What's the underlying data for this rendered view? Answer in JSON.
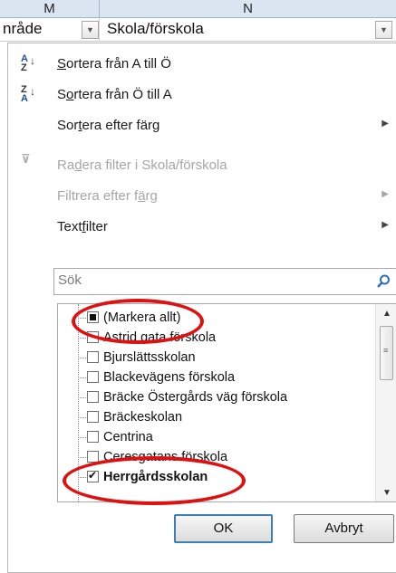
{
  "sheet": {
    "columns": [
      "M",
      "N"
    ],
    "header_cells": [
      "nråde",
      "Skola/förskola"
    ]
  },
  "menu": {
    "items": [
      {
        "label_pre": "",
        "label_u": "S",
        "label_post": "ortera från A till Ö",
        "disabled": false,
        "submenu": false,
        "icon": "sort-a-z-icon"
      },
      {
        "label_pre": "S",
        "label_u": "o",
        "label_post": "rtera från Ö till A",
        "disabled": false,
        "submenu": false,
        "icon": "sort-z-a-icon"
      },
      {
        "label_pre": "Sor",
        "label_u": "t",
        "label_post": "era efter färg",
        "disabled": false,
        "submenu": true,
        "icon": ""
      },
      {
        "label_pre": "Ra",
        "label_u": "d",
        "label_post": "era filter i Skola/förskola",
        "disabled": true,
        "submenu": false,
        "icon": "clear-filter-icon"
      },
      {
        "label_pre": "Filtrera efter f",
        "label_u": "ä",
        "label_post": "rg",
        "disabled": true,
        "submenu": true,
        "icon": ""
      },
      {
        "label_pre": "Text",
        "label_u": "f",
        "label_post": "ilter",
        "disabled": false,
        "submenu": true,
        "icon": ""
      }
    ],
    "search_placeholder": "Sök",
    "list": [
      {
        "label": "(Markera allt)",
        "state": "mixed"
      },
      {
        "label": "Astrid gata förskola",
        "state": "unchecked"
      },
      {
        "label": "Bjurslättsskolan",
        "state": "unchecked"
      },
      {
        "label": "Blackevägens förskola",
        "state": "unchecked"
      },
      {
        "label": "Bräcke Östergårds väg förskola",
        "state": "unchecked"
      },
      {
        "label": "Bräckeskolan",
        "state": "unchecked"
      },
      {
        "label": "Centrina",
        "state": "unchecked"
      },
      {
        "label": "Ceresgatans förskola",
        "state": "unchecked"
      },
      {
        "label": "Herrgårdsskolan",
        "state": "checked"
      }
    ],
    "ok_label": "OK",
    "cancel_label": "Avbryt"
  },
  "colors": {
    "annotation": "#e01010",
    "header_bg": "#dbe5f1",
    "disabled_text": "#a6a6a6"
  }
}
